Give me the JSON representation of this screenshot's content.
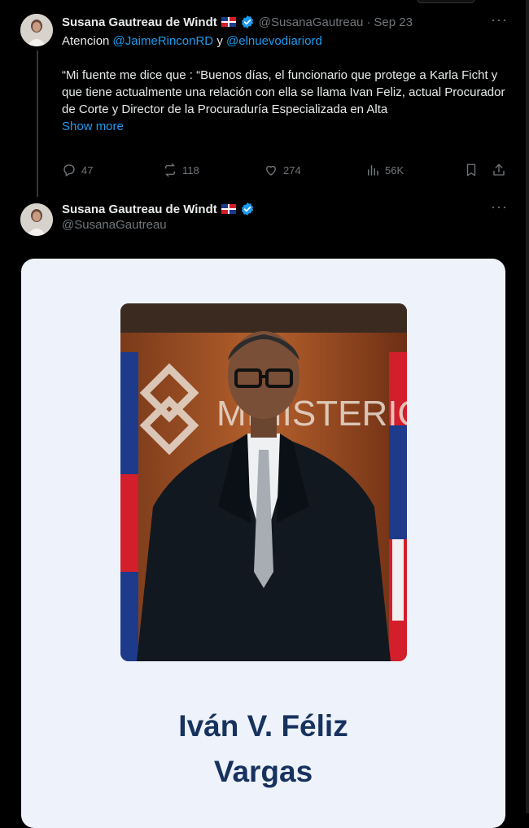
{
  "tweet1": {
    "author_name": "Susana Gautreau de Windt",
    "handle": "@SusanaGautreau",
    "separator": "·",
    "date": "Sep 23",
    "more": "···",
    "line1_prefix": "Atencion ",
    "mention1": "@JaimeRinconRD",
    "line1_mid": " y ",
    "mention2": "@elnuevodiariord",
    "paragraph": "“Mi fuente me dice que : “Buenos días, el funcionario que protege a Karla Ficht y que tiene actualmente una relación con ella se llama Ivan Feliz, actual Procurador de Corte y Director de la Procuraduría Especializada en Alta",
    "show_more": "Show more",
    "replies": "47",
    "reposts": "118",
    "likes": "274",
    "views": "56K"
  },
  "tweet2": {
    "author_name": "Susana Gautreau de Windt",
    "handle": "@SusanaGautreau",
    "more": "···"
  },
  "card": {
    "name_line1": "Iván V. Féliz",
    "name_line2": "Vargas",
    "backdrop_text": "MINISTERIO"
  },
  "icons": {
    "flag": "dominican-republic-flag-icon",
    "verified": "verified-badge-icon",
    "reply": "reply-icon",
    "repost": "repost-icon",
    "like": "like-icon",
    "views": "views-icon",
    "bookmark": "bookmark-icon",
    "share": "share-icon"
  },
  "colors": {
    "background": "#000000",
    "text": "#e7e9ea",
    "muted": "#71767b",
    "link": "#1d9bf0",
    "card_bg": "#eef3fb",
    "card_title": "#17325e"
  }
}
